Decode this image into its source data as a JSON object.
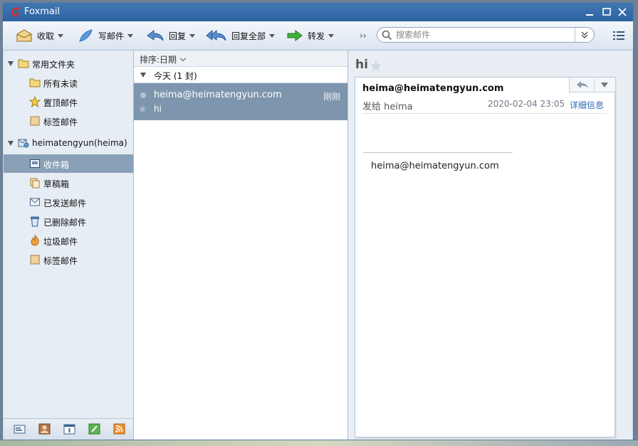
{
  "window": {
    "title": "Foxmail"
  },
  "toolbar": {
    "receive_label": "收取",
    "compose_label": "写邮件",
    "reply_label": "回复",
    "reply_all_label": "回复全部",
    "forward_label": "转发",
    "more_label": "››"
  },
  "search": {
    "placeholder": "搜索邮件",
    "value": ""
  },
  "sidebar": {
    "favorites": {
      "label": "常用文件夹",
      "items": [
        "所有未读",
        "置顶邮件",
        "标签邮件"
      ]
    },
    "account": {
      "label": "heimatengyun(heima)",
      "items": [
        "收件箱",
        "草稿箱",
        "已发送邮件",
        "已删除邮件",
        "垃圾邮件",
        "标签邮件"
      ],
      "selected": "收件箱"
    }
  },
  "maillist": {
    "sort_label": "排序:日期",
    "group_label": "今天 (1 封)",
    "items": [
      {
        "from": "heima@heimatengyun.com",
        "time": "刚刚",
        "subject": "hi"
      }
    ]
  },
  "reader": {
    "subject": "hi",
    "from": "heima@heimatengyun.com",
    "to": "发给 heima",
    "date": "2020-02-04 23:05",
    "detail_link": "详细信息",
    "body": "heima@heimatengyun.com"
  },
  "colors": {
    "titlebar": "#3f77b3",
    "selected_row": "#7e96ad",
    "link": "#2e6ab4",
    "logo": "#e02a1e"
  }
}
